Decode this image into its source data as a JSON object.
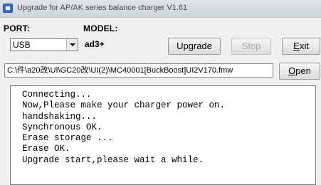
{
  "window": {
    "title": "Upgrade for AP/AK series balance charger V1.61",
    "icon": "app-icon"
  },
  "port": {
    "label": "PORT:",
    "value": "USB"
  },
  "model": {
    "label": "MODEL:",
    "value": "ad3+"
  },
  "buttons": {
    "upgrade": "Upgrade",
    "stop": "Stop",
    "exit": "Exit",
    "open": "Open"
  },
  "file_path": "C:\\件\\a20改\\UI\\GC20改\\UI(2)\\MC40001[BuckBoost]UI2V170.fmw",
  "log_lines": [
    "Connecting...",
    "Now,Please make your charger power on.",
    "handshaking...",
    "Synchronous OK.",
    "Erase storage ...",
    "Erase OK.",
    "Upgrade start,please wait a while."
  ]
}
